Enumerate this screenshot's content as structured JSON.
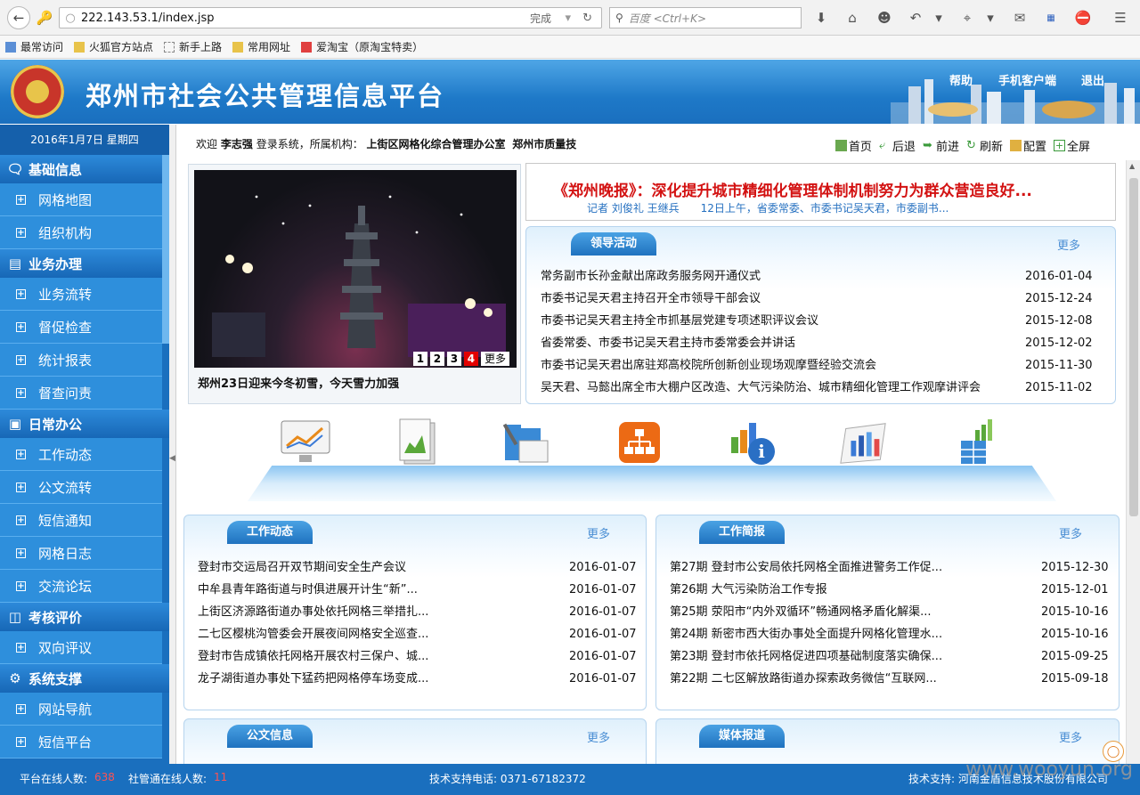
{
  "browser": {
    "url": "222.143.53.1/index.jsp",
    "status": "完成",
    "search_placeholder": "百度 <Ctrl+K>",
    "bookmarks": [
      "最常访问",
      "火狐官方站点",
      "新手上路",
      "常用网址",
      "爱淘宝（原淘宝特卖）"
    ]
  },
  "header": {
    "title": "郑州市社会公共管理信息平台",
    "links": [
      "帮助",
      "手机客户端",
      "退出"
    ]
  },
  "sidebar": {
    "date": "2016年1月7日 星期四",
    "sections": [
      {
        "label": "基础信息",
        "items": [
          "网格地图",
          "组织机构"
        ]
      },
      {
        "label": "业务办理",
        "items": [
          "业务流转",
          "督促检查",
          "统计报表",
          "督查问责"
        ]
      },
      {
        "label": "日常办公",
        "items": [
          "工作动态",
          "公文流转",
          "短信通知",
          "网格日志",
          "交流论坛"
        ]
      },
      {
        "label": "考核评价",
        "items": [
          "双向评议"
        ]
      },
      {
        "label": "系统支撑",
        "items": [
          "网站导航",
          "短信平台"
        ]
      }
    ]
  },
  "welcome": {
    "prefix": "欢迎",
    "user": "李志强",
    "mid": "登录系统，所属机构：",
    "org": "上街区网格化综合管理办公室",
    "unit": "郑州市质量技"
  },
  "toolbar": [
    "首页",
    "后退",
    "前进",
    "刷新",
    "配置",
    "全屏"
  ],
  "slideshow": {
    "caption": "郑州23日迎来今冬初雪，今天雪力加强",
    "pages": [
      "1",
      "2",
      "3",
      "4"
    ],
    "active": "4",
    "more": "更多"
  },
  "headline": {
    "title": "《郑州晚报》：深化提升城市精细化管理体制机制努力为群众营造良好...",
    "sub": "记者 刘俊礼 王继兵　　12日上午，省委常委、市委书记吴天君，市委副书..."
  },
  "leader": {
    "tab": "领导活动",
    "more": "更多",
    "rows": [
      {
        "t": "常务副市长孙金献出席政务服务网开通仪式",
        "d": "2016-01-04"
      },
      {
        "t": "市委书记吴天君主持召开全市领导干部会议",
        "d": "2015-12-24"
      },
      {
        "t": "市委书记吴天君主持全市抓基层党建专项述职评议会议",
        "d": "2015-12-08"
      },
      {
        "t": "省委常委、市委书记吴天君主持市委常委会并讲话",
        "d": "2015-12-02"
      },
      {
        "t": "市委书记吴天君出席驻郑高校院所创新创业现场观摩暨经验交流会",
        "d": "2015-11-30"
      },
      {
        "t": "吴天君、马懿出席全市大棚户区改造、大气污染防治、城市精细化管理工作观摩讲评会",
        "d": "2015-11-02"
      }
    ]
  },
  "work": {
    "tab": "工作动态",
    "more": "更多",
    "rows": [
      {
        "t": "登封市交运局召开双节期间安全生产会议",
        "d": "2016-01-07"
      },
      {
        "t": "中牟县青年路街道与时俱进展开计生“新”...",
        "d": "2016-01-07"
      },
      {
        "t": "上街区济源路街道办事处依托网格三举措扎...",
        "d": "2016-01-07"
      },
      {
        "t": "二七区樱桃沟管委会开展夜间网格安全巡查...",
        "d": "2016-01-07"
      },
      {
        "t": "登封市告成镇依托网格开展农村三保户、城...",
        "d": "2016-01-07"
      },
      {
        "t": "龙子湖街道办事处下猛药把网格停车场变成...",
        "d": "2016-01-07"
      }
    ]
  },
  "brief": {
    "tab": "工作简报",
    "more": "更多",
    "rows": [
      {
        "t": "第27期 登封市公安局依托网格全面推进警务工作促...",
        "d": "2015-12-30"
      },
      {
        "t": "第26期  大气污染防治工作专报",
        "d": "2015-12-01"
      },
      {
        "t": "第25期 荥阳市“内外双循环”畅通网格矛盾化解渠...",
        "d": "2015-10-16"
      },
      {
        "t": "第24期 新密市西大街办事处全面提升网格化管理水...",
        "d": "2015-10-16"
      },
      {
        "t": "第23期 登封市依托网格促进四项基础制度落实确保...",
        "d": "2015-09-25"
      },
      {
        "t": "第22期 二七区解放路街道办探索政务微信“互联网...",
        "d": "2015-09-18"
      }
    ]
  },
  "doc": {
    "tab": "公文信息",
    "more": "更多"
  },
  "media": {
    "tab": "媒体报道",
    "more": "更多"
  },
  "status": {
    "online_label": "平台在线人数:",
    "online": "638",
    "sg_label": "社管通在线人数:",
    "sg": "11",
    "phone": "技术支持电话: 0371-67182372",
    "support": "技术支持: 河南金盾信息技术股份有限公司",
    "watermark": "www.wooyun.org"
  }
}
